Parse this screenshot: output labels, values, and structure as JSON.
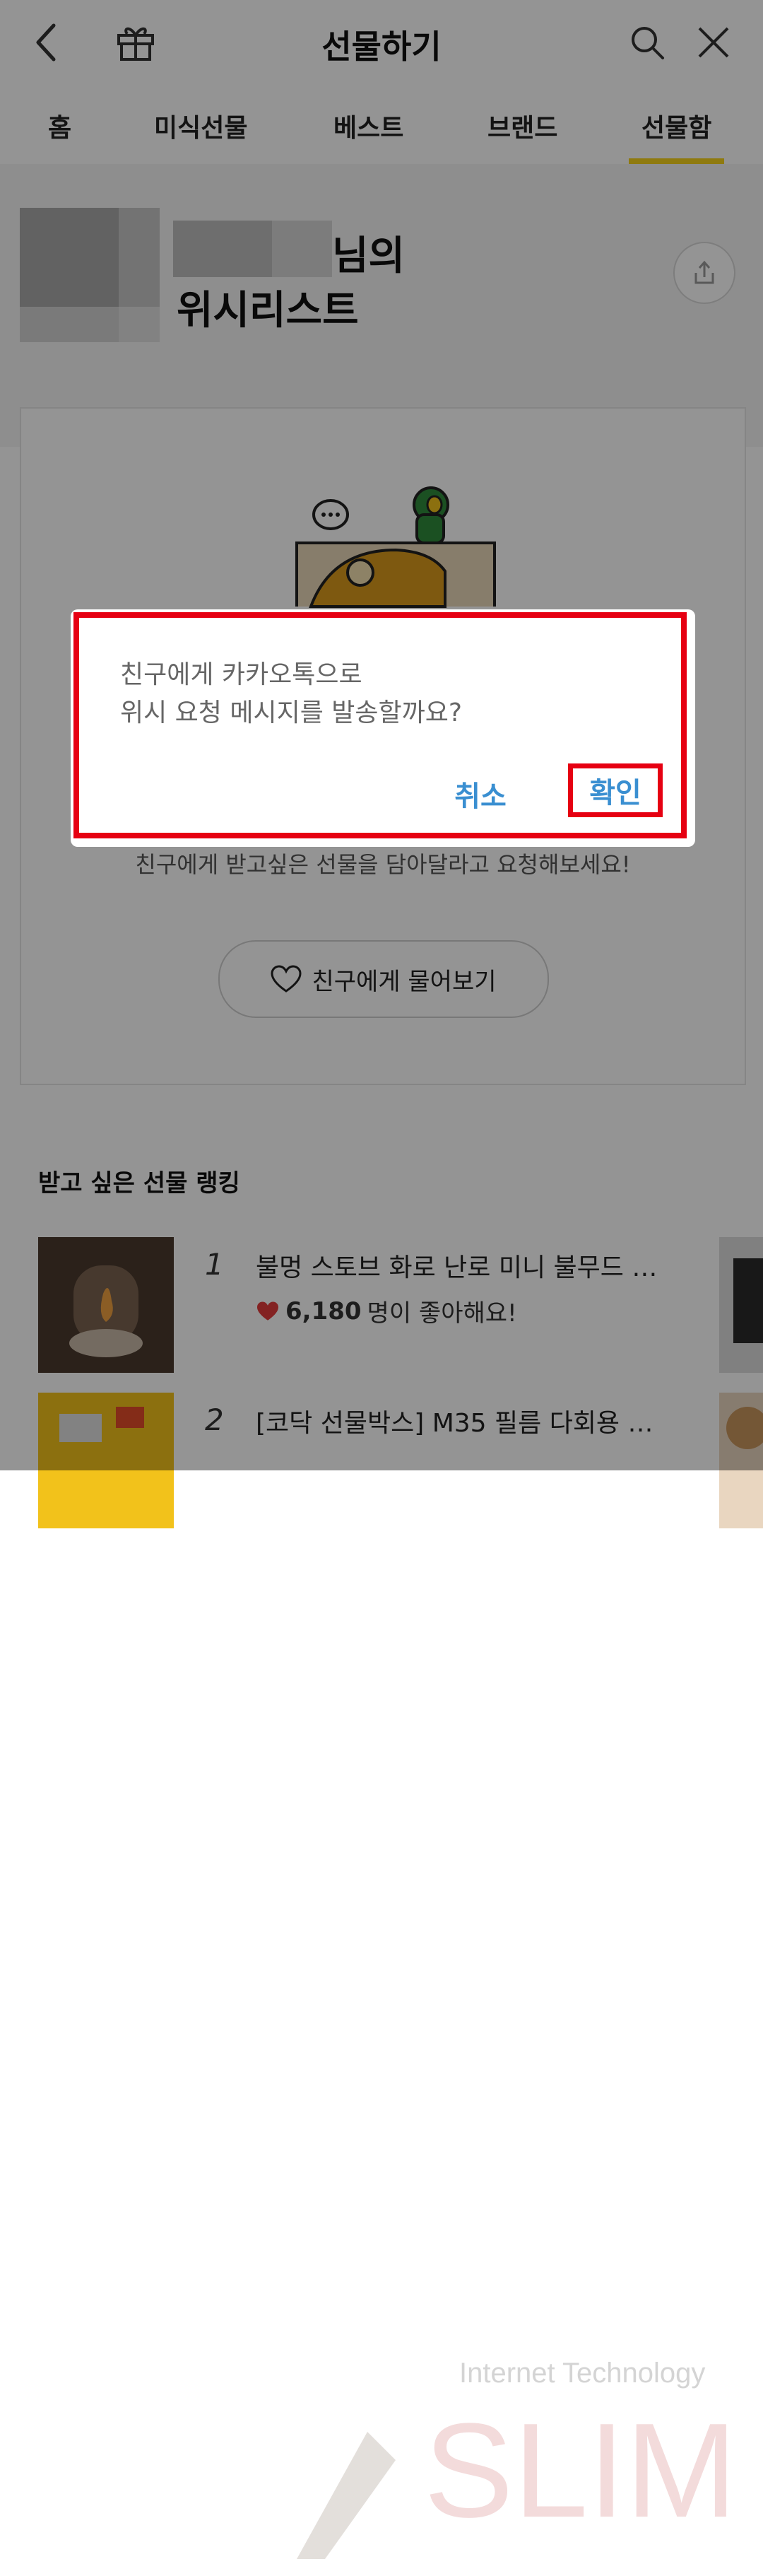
{
  "header": {
    "title": "선물하기",
    "icons": [
      "back-icon",
      "gift-icon",
      "search-icon",
      "close-icon"
    ]
  },
  "tabs": [
    {
      "label": "홈"
    },
    {
      "label": "미식선물"
    },
    {
      "label": "베스트"
    },
    {
      "label": "브랜드"
    },
    {
      "label": "선물함",
      "active": true
    }
  ],
  "profile": {
    "name_suffix": "님의",
    "wishlist_title": "위시리스트"
  },
  "empty_state": {
    "message": "친구에게 받고싶은 선물을 담아달라고 요청해보세요!",
    "ask_button": "친구에게 물어보기"
  },
  "ranking": {
    "title": "받고 싶은 선물 랭킹",
    "items": [
      {
        "rank": "1",
        "name": "불멍 스토브 화로 난로 미니 불무드 에...",
        "likes": "6,180",
        "likes_suffix": "명이 좋아해요!"
      },
      {
        "rank": "2",
        "name": "[코닥 선물박스] M35 필름 다회용 토..."
      }
    ]
  },
  "dialog": {
    "line1": "친구에게 카카오톡으로",
    "line2": "위시 요청 메시지를 발송할까요?",
    "cancel": "취소",
    "confirm": "확인"
  },
  "watermark": {
    "line1": "Internet Technology",
    "line2": "SLIM"
  },
  "colors": {
    "accent_yellow": "#f7d21b",
    "dialog_button_blue": "#3a8fd1",
    "highlight_red": "#e60012",
    "heart_red": "#e23b3b"
  }
}
